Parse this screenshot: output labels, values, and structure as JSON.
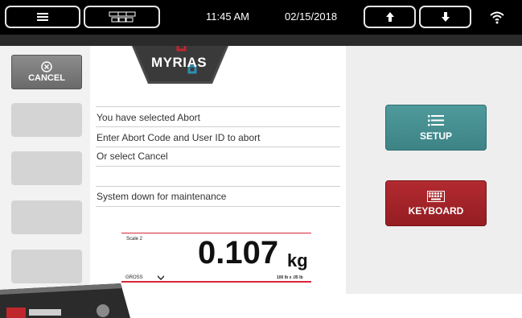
{
  "topbar": {
    "menu_icon": "hamburger-icon",
    "grid_icon": "grid-icon",
    "time": "11:45 AM",
    "date": "02/15/2018",
    "up_icon": "arrow-up-icon",
    "down_icon": "arrow-down-icon",
    "wifi_icon": "wifi-icon"
  },
  "brand": {
    "logo_text": "MYRIAS"
  },
  "sidebar": {
    "cancel_label": "CANCEL",
    "cancel_icon": "cancel-circle-icon"
  },
  "messages": {
    "line1": "You have selected Abort",
    "line2": "Enter Abort Code and User ID to abort",
    "line3": "Or select Cancel",
    "line4": "",
    "line5": "System down for maintenance"
  },
  "scale": {
    "name": "Scale 2",
    "value": "0.107",
    "unit": "kg",
    "mode": "GROSS",
    "capacity": "100 lb x .05 lb"
  },
  "actions": {
    "setup_label": "SETUP",
    "keyboard_label": "KEYBOARD",
    "setup_icon": "list-icon",
    "keyboard_icon": "keyboard-icon"
  },
  "colors": {
    "setup": "#4a9294",
    "keyboard": "#a6252a",
    "scale_rule": "#d9263a",
    "logo_red": "#c0272d",
    "logo_blue": "#2f8fb0"
  }
}
